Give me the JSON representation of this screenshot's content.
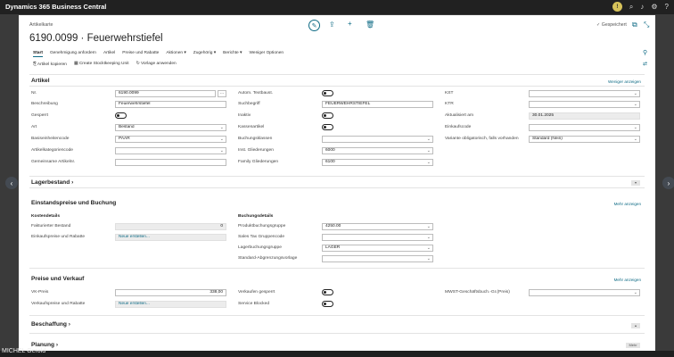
{
  "app": {
    "title": "Dynamics 365 Business Central"
  },
  "header": {
    "breadcrumb": "Artikelkarte",
    "page_title": "6190.0099 · Feuerwehrstiefel",
    "saved_status": "✓ Gespeichert"
  },
  "menu": {
    "items": [
      "Start",
      "Genehmigung anfordern",
      "Artikel",
      "Preise und Rabatte",
      "Aktionen ▾",
      "Zugehörig ▾",
      "Berichte ▾",
      "Weniger Optionen"
    ]
  },
  "actions": {
    "items": [
      "Artikel kopieren",
      "Create Stocktkeeping Unit",
      "Vorlage anwenden"
    ]
  },
  "artikel": {
    "title": "Artikel",
    "show_less": "Weniger anzeigen",
    "fields": {
      "nr_label": "Nr.",
      "nr_value": "6190.0099",
      "beschreibung_label": "Beschreibung",
      "beschreibung_value": "Feuerwehrstiefel",
      "gesperrt_label": "Gesperrt",
      "art_label": "Art",
      "art_value": "Bestand",
      "basiseinheit_label": "Basiseinheitencode",
      "basiseinheit_value": "PAAR",
      "kategorie_label": "Artikelkategoriencode",
      "gemeinsame_label": "Gemeinsame Artikelnr.",
      "autoext_label": "Autom. Textbaust.",
      "suchbegriff_label": "Suchbegriff",
      "suchbegriff_value": "FEUERWEHRSTIEFEL",
      "inaktiv_label": "Inaktiv",
      "kassenartikel_label": "Kassenartikel",
      "buchungsklassen_label": "Buchungsklassen",
      "inst_gliederung_label": "Inst. Gliederungen",
      "inst_gliederung_value": "6000",
      "family_label": "Family Gliederungen",
      "family_value": "6100",
      "kst_label": "KST",
      "ktr_label": "KTR",
      "aktualisiert_label": "Aktualisiert am",
      "aktualisiert_value": "30.01.2025",
      "einkauf_label": "Einkaufscode",
      "variante_label": "Variante obligatorisch, falls vorhanden",
      "variante_value": "Standard (Nein)"
    }
  },
  "lagerbestand": {
    "title": "Lagerbestand"
  },
  "einstand": {
    "title": "Einstandspreise und Buchung",
    "show_more": "Mehr anzeigen",
    "kosten_heading": "Kostendetails",
    "fakt_label": "Fakturierter Bestand",
    "fakt_value": "0",
    "einkaufspreise_label": "Einkaufspreise und Rabatte",
    "einkaufspreise_value": "Neue erstellen...",
    "buchung_heading": "Buchungsdetails",
    "produkt_label": "Produktbuchungsgruppe",
    "produkt_value": "4250.00",
    "sales_label": "Sales Tax Gruppencode",
    "lager_label": "Lagerbuchungsgruppe",
    "lager_value": "LAGER",
    "standard_label": "Standard-Abgrenzungsvorlage"
  },
  "preise": {
    "title": "Preise und Verkauf",
    "show_more": "Mehr anzeigen",
    "vkpreis_label": "VK-Preis",
    "vkpreis_value": "338,00",
    "verkaufspreise_label": "Verkaufspreise und Rabatte",
    "verkaufspreise_value": "Neue erstellen...",
    "verkauf_gesperrt_label": "Verkaufen gesperrt",
    "service_label": "Service Blocked",
    "mwst_label": "MWST-Geschäftsbuch.-Gr.(Preis)"
  },
  "beschaffung": {
    "title": "Beschaffung"
  },
  "planung": {
    "title": "Planung",
    "more": "Mehr"
  },
  "taskbar": {
    "user": "MICHEL Gerold"
  }
}
